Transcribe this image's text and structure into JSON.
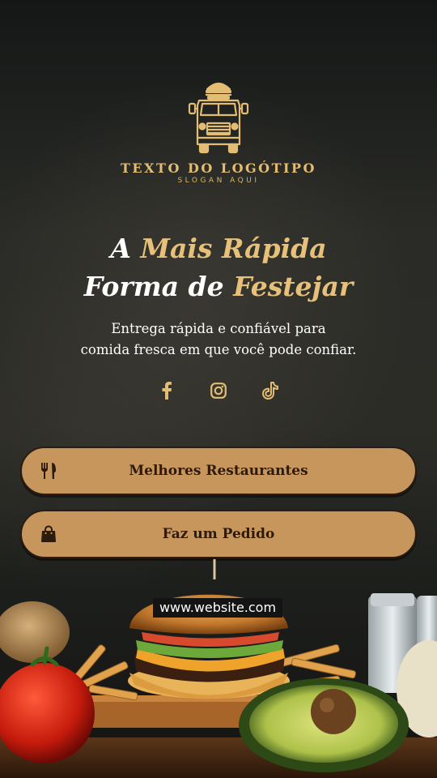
{
  "logo": {
    "title": "TEXTO DO LOGÓTIPO",
    "slogan": "SLOGAN AQUI"
  },
  "headline": {
    "word1": "A",
    "gold1": "Mais Rápida",
    "line2_white": "Forma de",
    "gold2": "Festejar"
  },
  "subtitle": {
    "line1": "Entrega rápida e confiável para",
    "line2": "comida fresca em que você pode confiar."
  },
  "social": [
    {
      "icon": "facebook-icon"
    },
    {
      "icon": "instagram-icon"
    },
    {
      "icon": "tiktok-icon"
    }
  ],
  "buttons": [
    {
      "label": "Melhores Restaurantes",
      "icon": "utensils-icon"
    },
    {
      "label": "Faz um Pedido",
      "icon": "shopping-bag-icon"
    }
  ],
  "website": "www.website.com",
  "colors": {
    "gold": "#e2bd73",
    "button": "#c7965d",
    "button_text": "#2c1b0d"
  }
}
